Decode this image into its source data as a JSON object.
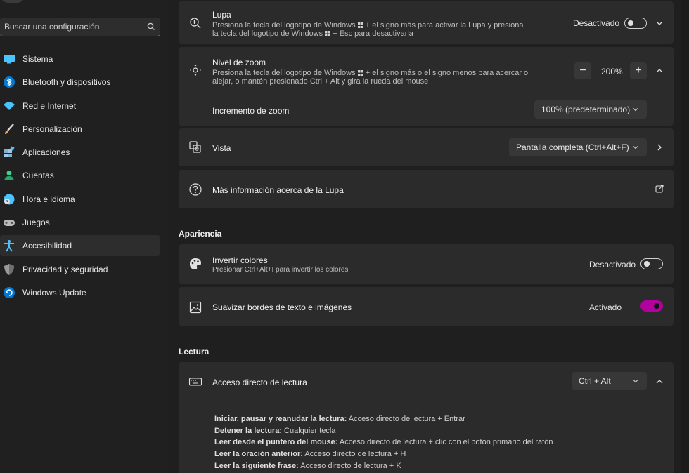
{
  "sidebar": {
    "search": {
      "placeholder": "Buscar una configuración"
    },
    "items": [
      {
        "label": "Sistema",
        "icon": "monitor-icon"
      },
      {
        "label": "Bluetooth y dispositivos",
        "icon": "bluetooth-icon"
      },
      {
        "label": "Red e Internet",
        "icon": "wifi-icon"
      },
      {
        "label": "Personalización",
        "icon": "brush-icon"
      },
      {
        "label": "Aplicaciones",
        "icon": "apps-icon"
      },
      {
        "label": "Cuentas",
        "icon": "person-icon"
      },
      {
        "label": "Hora e idioma",
        "icon": "globe-clock-icon"
      },
      {
        "label": "Juegos",
        "icon": "gamepad-icon"
      },
      {
        "label": "Accesibilidad",
        "icon": "accessibility-icon",
        "active": true
      },
      {
        "label": "Privacidad y seguridad",
        "icon": "shield-icon"
      },
      {
        "label": "Windows Update",
        "icon": "update-icon"
      }
    ]
  },
  "lupa": {
    "title": "Lupa",
    "desc_1a": "Presiona la tecla del logotipo de Windows",
    "desc_1b": "+ el signo más para activar la Lupa y presiona",
    "desc_2a": "la tecla del logotipo de Windows",
    "desc_2b": "+ Esc para desactivarla",
    "state": "Desactivado",
    "enabled": false
  },
  "zoom": {
    "title": "Nivel de zoom",
    "desc_1a": "Presiona la tecla del logotipo de Windows",
    "desc_1b": "+ el signo más o el signo menos para acercar o",
    "desc_2": "alejar, o mantén presionado Ctrl + Alt y gira la rueda del mouse",
    "minus": "−",
    "value": "200%",
    "plus": "+",
    "increment_label": "Incremento de zoom",
    "increment_value": "100% (predeterminado)"
  },
  "vista": {
    "title": "Vista",
    "value": "Pantalla completa (Ctrl+Alt+F)"
  },
  "more_info": {
    "title": "Más información acerca de la Lupa"
  },
  "apariencia": {
    "section": "Apariencia",
    "invert": {
      "title": "Invertir colores",
      "desc": "Presionar Ctrl+Alt+I para invertir los colores",
      "state": "Desactivado",
      "enabled": false
    },
    "smooth": {
      "title": "Suavizar bordes de texto e imágenes",
      "state": "Activado",
      "enabled": true
    }
  },
  "lectura": {
    "section": "Lectura",
    "shortcut": {
      "title": "Acceso directo de lectura",
      "value": "Ctrl + Alt"
    },
    "lines": [
      {
        "bold": "Iniciar, pausar y reanudar la lectura:",
        "text": " Acceso directo de lectura + Entrar"
      },
      {
        "bold": "Detener la lectura:",
        "text": " Cualquier tecla"
      },
      {
        "bold": "Leer desde el puntero del mouse:",
        "text": " Acceso directo de lectura + clic con el botón primario del ratón"
      },
      {
        "bold": "Leer la oración anterior:",
        "text": " Acceso directo de lectura + H"
      },
      {
        "bold": "Leer la siguiente frase:",
        "text": " Acceso directo de lectura + K"
      }
    ]
  },
  "colors": {
    "accent": "#b4009e",
    "card": "#2b2b2b",
    "bg": "#1f1f1f"
  }
}
